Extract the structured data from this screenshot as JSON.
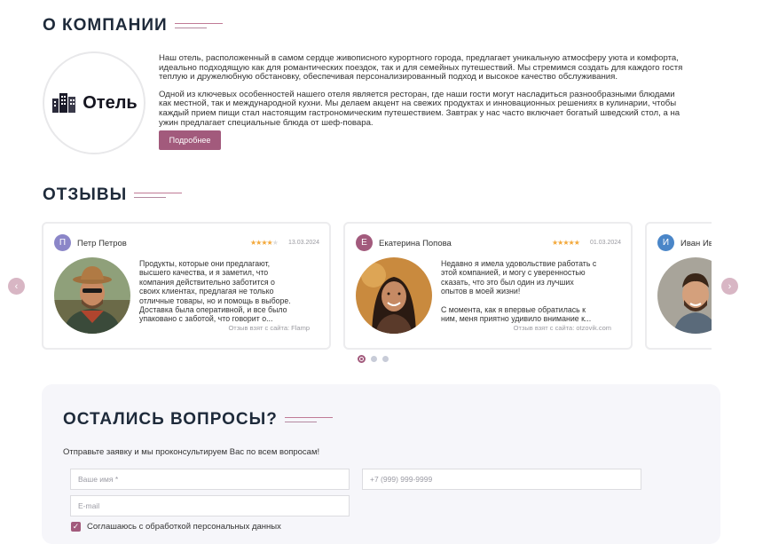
{
  "about": {
    "title": "О КОМПАНИИ",
    "logo_text": "Отель",
    "paragraph1": [
      "Наш отель, расположенный в самом сердце живописного курортного города, предлагает уникальную атмосферу уюта и комфорта,",
      "идеально подходящую как для романтических поездок, так и для семейных путешествий. Мы стремимся создать для каждого гостя",
      "теплую и дружелюбную обстановку, обеспечивая персонализированный подход и высокое качество обслуживания."
    ],
    "paragraph2": [
      "Одной из ключевых особенностей нашего отеля является ресторан, где наши гости могут насладиться разнообразными блюдами",
      "как местной, так и международной кухни. Мы делаем акцент на свежих продуктах и инновационных решениях в кулинарии, чтобы",
      "каждый прием пищи стал настоящим гастрономическим путешествием. Завтрак у нас часто включает богатый шведский стол, а на",
      "ужин предлагает специальные блюда от шеф-повара."
    ],
    "button_label": "Подробнее"
  },
  "reviews": {
    "title": "ОТЗЫВЫ",
    "prev_arrow": "‹",
    "next_arrow": "›",
    "items": [
      {
        "initial": "П",
        "avatar_color": "#8b86c8",
        "name": "Петр Петров",
        "rating": 4,
        "date": "13.03.2024",
        "text": [
          "Продукты, которые они предлагают,",
          "высшего качества, и я заметил, что",
          "компания действительно заботится о",
          "своих клиентах, предлагая не только",
          "отличные товары, но и помощь в выборе.",
          "Доставка была оперативной, и все было",
          "упаковано с заботой, что говорит о..."
        ],
        "source": "Отзыв взят с сайта: Flamp"
      },
      {
        "initial": "Е",
        "avatar_color": "#a25a7c",
        "name": "Екатерина Попова",
        "rating": 5,
        "date": "01.03.2024",
        "text": [
          "Недавно я имела удовольствие работать с",
          "этой компанией, и могу с уверенностью",
          "сказать, что это был один из лучших",
          "опытов в моей жизни!",
          "",
          "С момента, как я впервые обратилась к",
          "ним, меня приятно удивило внимание к..."
        ],
        "source": "Отзыв взят с сайта: otzovik.com"
      },
      {
        "initial": "И",
        "avatar_color": "#4a86c8",
        "name": "Иван Ива",
        "rating": 0,
        "date": "",
        "text": [],
        "source": ""
      }
    ],
    "pagination": {
      "count": 3,
      "active": 0
    }
  },
  "contact": {
    "title": "ОСТАЛИСЬ ВОПРОСЫ?",
    "subtitle": "Отправьте заявку и мы проконсультируем Вас по всем вопросам!",
    "name_placeholder": "Ваше имя *",
    "phone_placeholder": "+7 (999) 999-9999",
    "email_placeholder": "E-mail",
    "consent_label": "Соглашаюсь с обработкой персональных данных",
    "consent_checked": true
  },
  "colors": {
    "accent": "#a25a7c",
    "heading": "#1e2a3a",
    "star": "#f3a83a"
  }
}
